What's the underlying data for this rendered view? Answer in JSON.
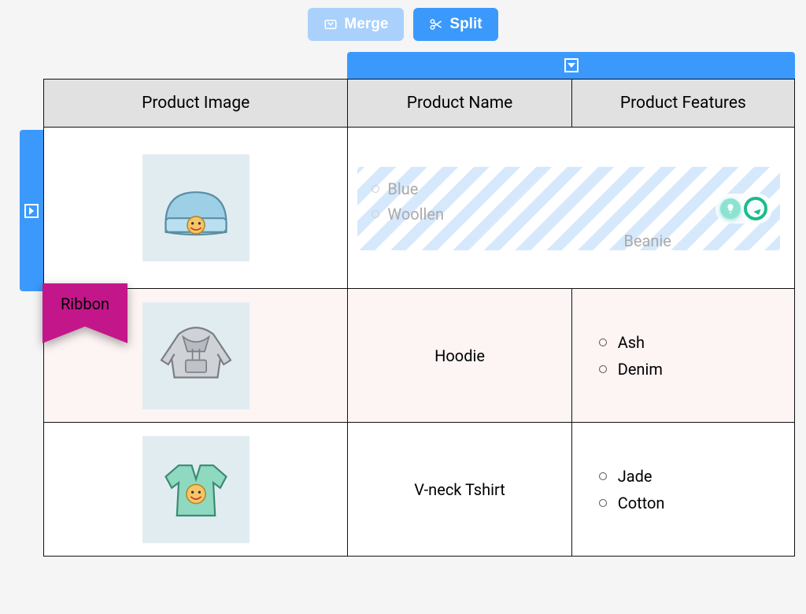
{
  "toolbar": {
    "merge_label": "Merge",
    "split_label": "Split"
  },
  "table": {
    "headers": {
      "image": "Product Image",
      "name": "Product Name",
      "features": "Product Features"
    },
    "rows": [
      {
        "image_alt": "beanie",
        "merged_name": "Beanie",
        "merged_features": [
          "Blue",
          "Woollen"
        ]
      },
      {
        "image_alt": "hoodie",
        "name": "Hoodie",
        "features": [
          "Ash",
          "Denim"
        ],
        "ribbon_label": "Ribbon"
      },
      {
        "image_alt": "vneck-tshirt",
        "name": "V-neck Tshirt",
        "features": [
          "Jade",
          "Cotton"
        ]
      }
    ]
  }
}
